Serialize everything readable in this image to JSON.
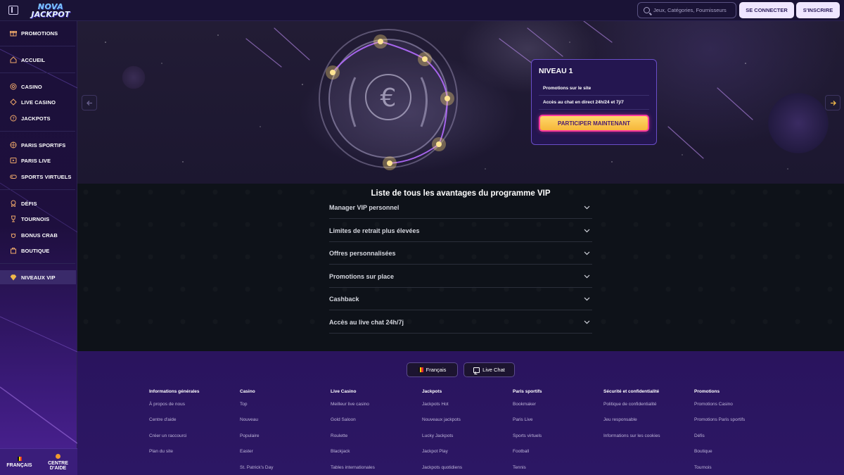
{
  "colors": {
    "accent": "#efe6ff",
    "card_border": "#6a4ec8",
    "join_button": "#f6b73a",
    "join_border": "#ff3aa0",
    "sidebar_bg": "#1b1038",
    "footer_bg": "#2a145e"
  },
  "header": {
    "logo_line1": "NOVA",
    "logo_line2": "JACKPOT",
    "search_placeholder": "Jeux, Catégories, Fournisseurs",
    "login_label": "SE CONNECTER",
    "signup_label": "S'INSCRIRE"
  },
  "sidebar": {
    "items": [
      {
        "label": "PROMOTIONS",
        "icon": "gift-icon"
      },
      {
        "label": "ACCUEIL",
        "icon": "home-icon"
      },
      {
        "label": "CASINO",
        "icon": "chip-icon"
      },
      {
        "label": "LIVE CASINO",
        "icon": "live-casino-icon"
      },
      {
        "label": "JACKPOTS",
        "icon": "jackpot-icon"
      },
      {
        "label": "PARIS SPORTIFS",
        "icon": "ball-icon"
      },
      {
        "label": "PARIS LIVE",
        "icon": "live-bet-icon"
      },
      {
        "label": "SPORTS VIRTUELS",
        "icon": "gamepad-icon"
      },
      {
        "label": "DÉFIS",
        "icon": "medal-icon"
      },
      {
        "label": "TOURNOIS",
        "icon": "trophy-icon"
      },
      {
        "label": "BONUS CRAB",
        "icon": "crab-icon"
      },
      {
        "label": "BOUTIQUE",
        "icon": "shop-icon"
      },
      {
        "label": "NIVEAUX VIP",
        "icon": "diamond-icon"
      }
    ],
    "language_label": "FRANÇAIS",
    "help_label_line1": "CENTRE",
    "help_label_line2": "D'AIDE"
  },
  "hero": {
    "level_title": "NIVEAU 1",
    "perks": [
      "Promotions sur le site",
      "Accès au chat en direct 24h/24 et 7j/7"
    ],
    "join_label": "PARTICIPER MAINTENANT"
  },
  "vip": {
    "title": "Liste de tous les avantages du programme VIP",
    "items": [
      "Manager VIP personnel",
      "Limites de retrait plus élevées",
      "Offres personnalisées",
      "Promotions sur place",
      "Cashback",
      "Accès au live chat 24h/7j"
    ]
  },
  "footer": {
    "language_label": "Français",
    "chat_label": "Live Chat",
    "columns": [
      {
        "title": "Informations générales",
        "links": [
          "À propos de nous",
          "Centre d'aide",
          "Créer un raccourci",
          "Plan du site"
        ]
      },
      {
        "title": "Casino",
        "links": [
          "Top",
          "Nouveau",
          "Populaire",
          "Easter",
          "St. Patrick's Day"
        ]
      },
      {
        "title": "Live Casino",
        "links": [
          "Meilleur live casino",
          "Gold Saloon",
          "Roulette",
          "Blackjack",
          "Tables internationales"
        ]
      },
      {
        "title": "Jackpots",
        "links": [
          "Jackpots Hot",
          "Nouveaux jackpots",
          "Lucky Jackpots",
          "Jackpot Play",
          "Jackpots quotidiens"
        ]
      },
      {
        "title": "Paris sportifs",
        "links": [
          "Bookmaker",
          "Paris Live",
          "Sports virtuels",
          "Football",
          "Tennis"
        ]
      },
      {
        "title": "Sécurité et confidentialité",
        "links": [
          "Politique de confidentialité",
          "Jeu responsable",
          "Informations sur les cookies"
        ]
      },
      {
        "title": "Promotions",
        "links": [
          "Promotions Casino",
          "Promotions Paris sportifs",
          "Défis",
          "Boutique",
          "Tournois"
        ]
      }
    ]
  }
}
